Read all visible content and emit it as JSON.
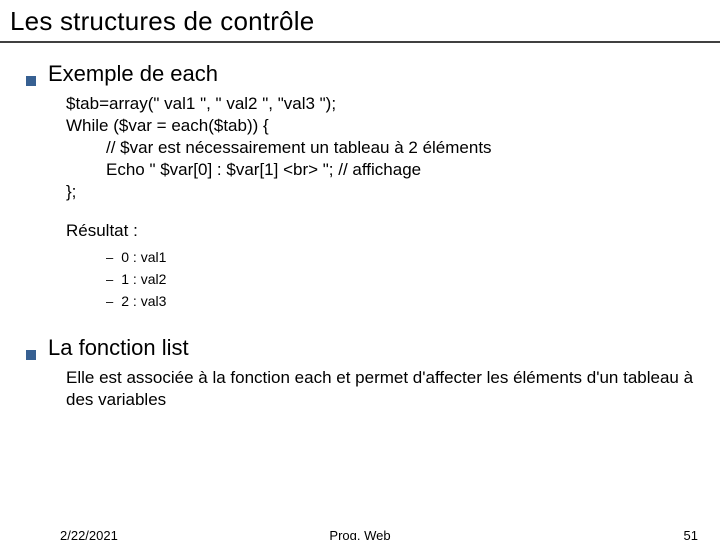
{
  "title": "Les structures de contrôle",
  "sections": [
    {
      "heading": "Exemple de each",
      "code": [
        "$tab=array(\" val1 \", \" val2 \", \"val3 \");",
        "While ($var = each($tab)) {"
      ],
      "code_indent": [
        "// $var est nécessairement un tableau à 2 éléments",
        "Echo \" $var[0] : $var[1] <br> \"; // affichage"
      ],
      "code_close": "};",
      "result_label": "Résultat :",
      "results": [
        "0 : val1",
        "1 : val2",
        "2 : val3"
      ]
    },
    {
      "heading": "La fonction list",
      "paragraph": "Elle est associée à la fonction each et permet d'affecter les éléments d'un tableau à des variables"
    }
  ],
  "footer": {
    "date": "2/22/2021",
    "center": "Prog. Web",
    "page": "51"
  }
}
